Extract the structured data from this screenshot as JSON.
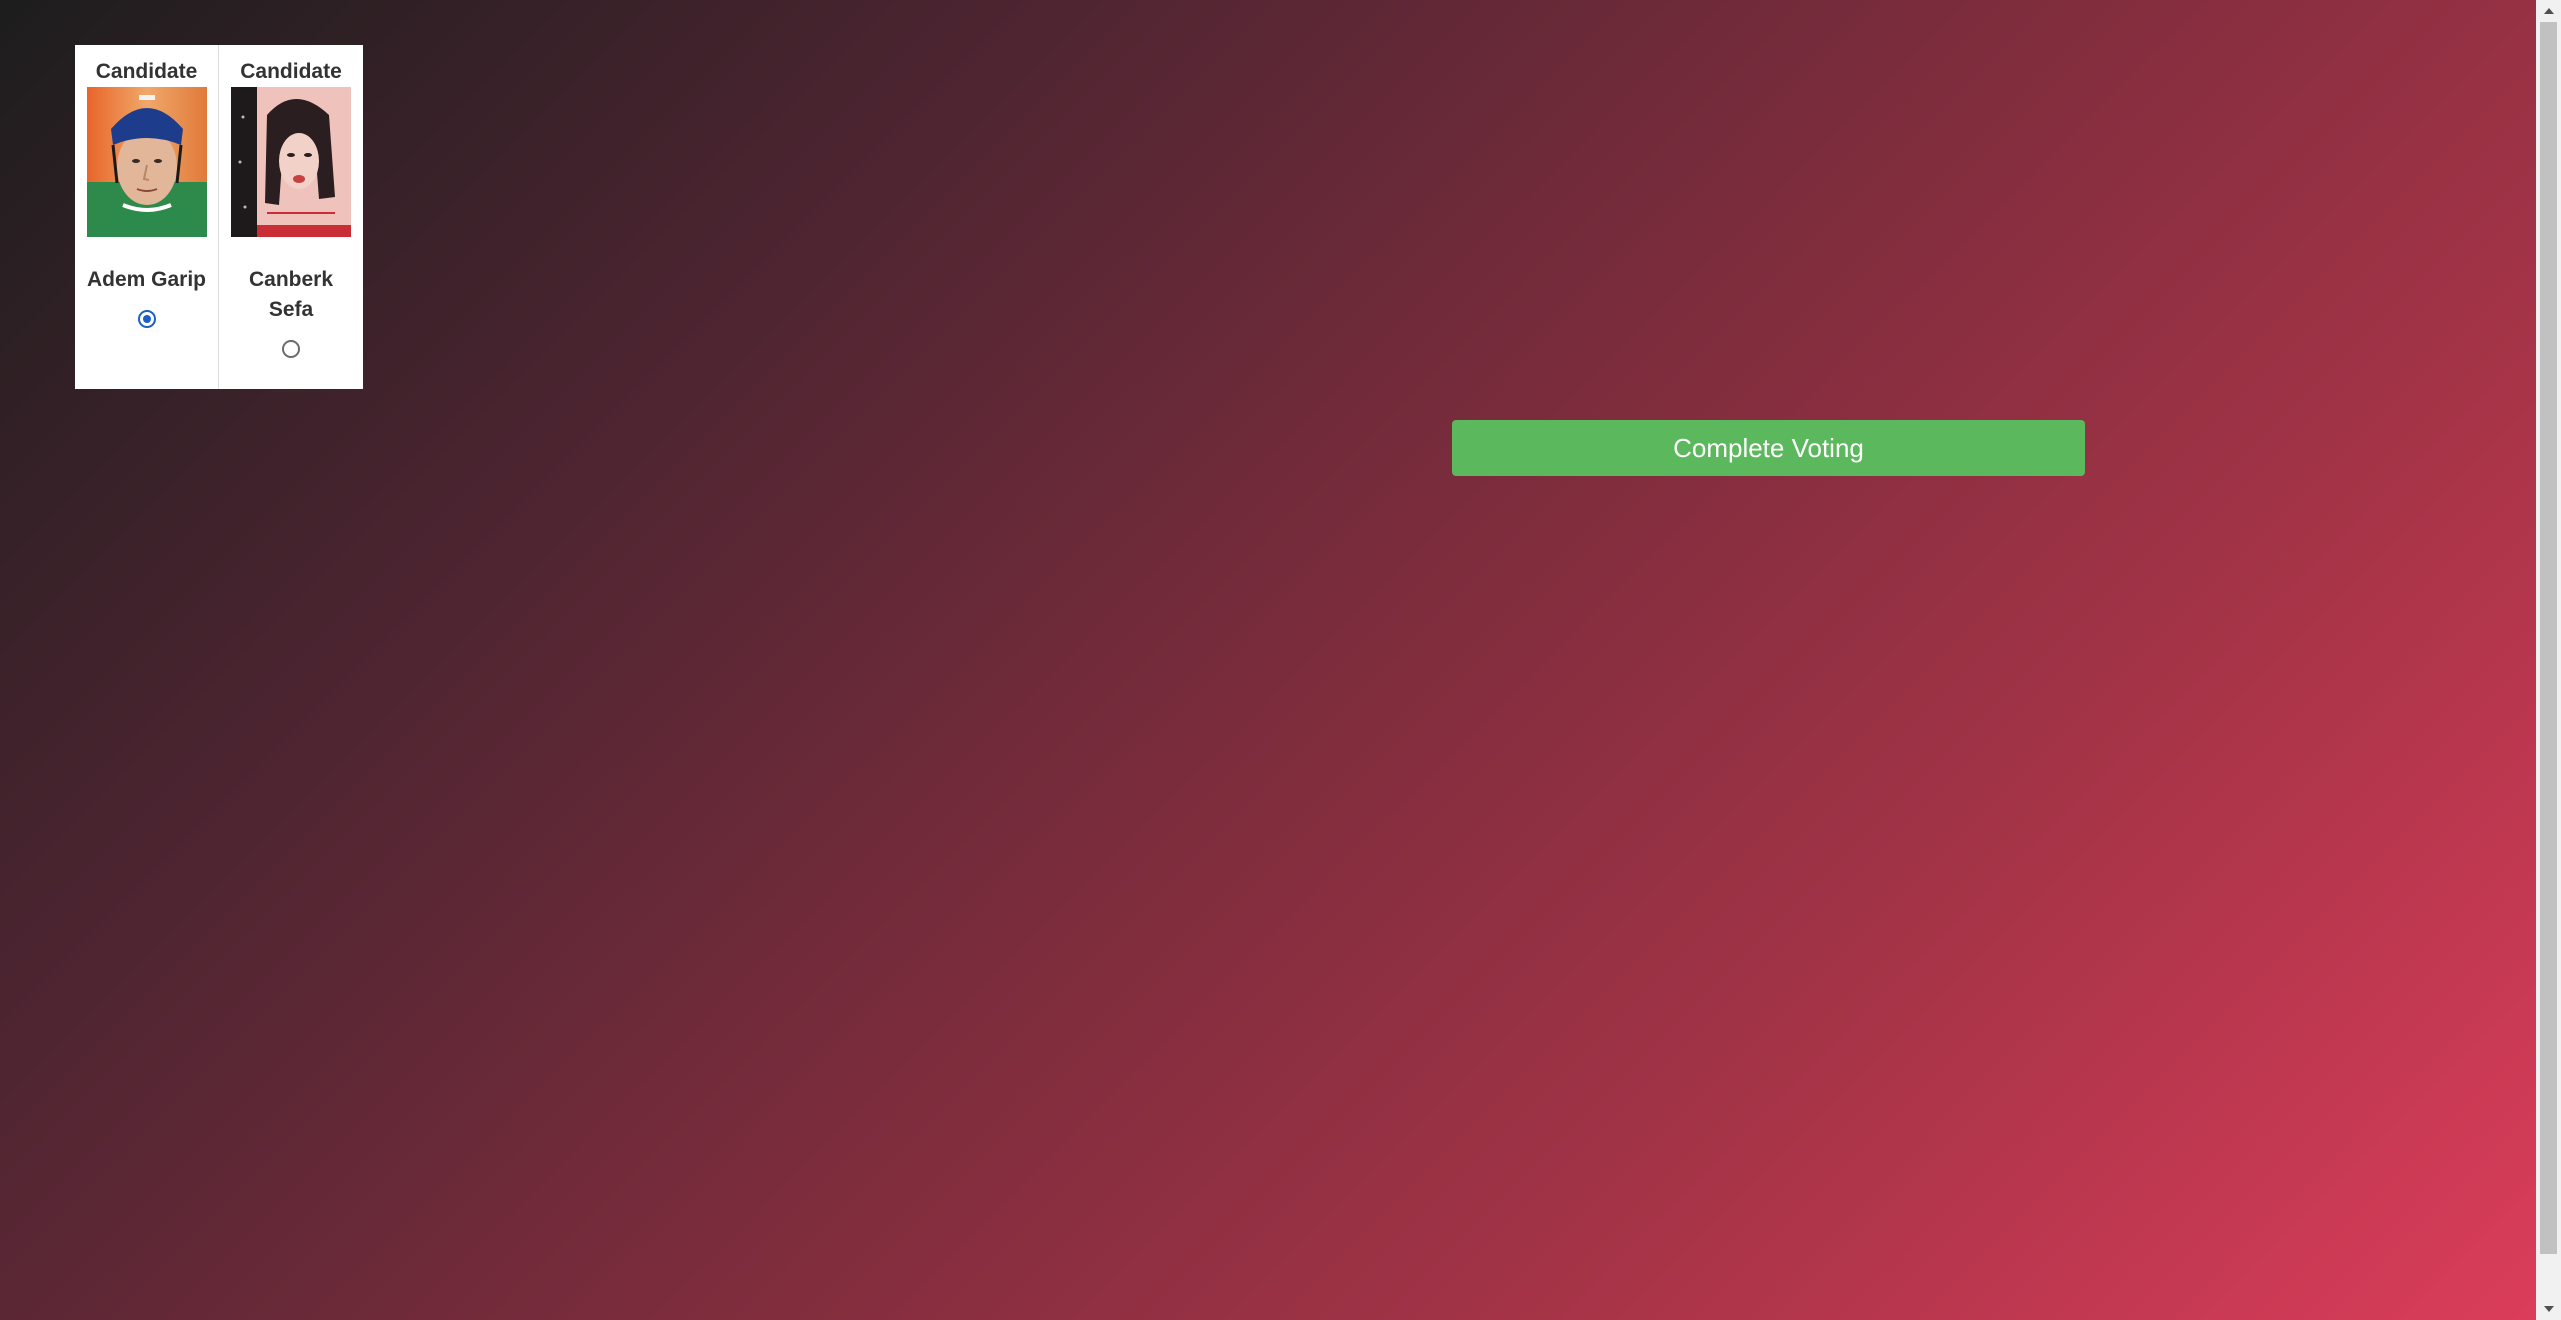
{
  "candidates": [
    {
      "heading": "Candidate",
      "name": "Adem Garip",
      "selected": true,
      "photo_icon": "hockey-player-photo"
    },
    {
      "heading": "Candidate",
      "name": "Canberk Sefa",
      "selected": false,
      "photo_icon": "painted-portrait-photo"
    }
  ],
  "actions": {
    "complete_label": "Complete Voting"
  },
  "colors": {
    "button_green": "#5cb85c",
    "radio_checked": "#1a5fc7",
    "gradient_start": "#1d1d1d",
    "gradient_end": "#dc3d5a"
  }
}
